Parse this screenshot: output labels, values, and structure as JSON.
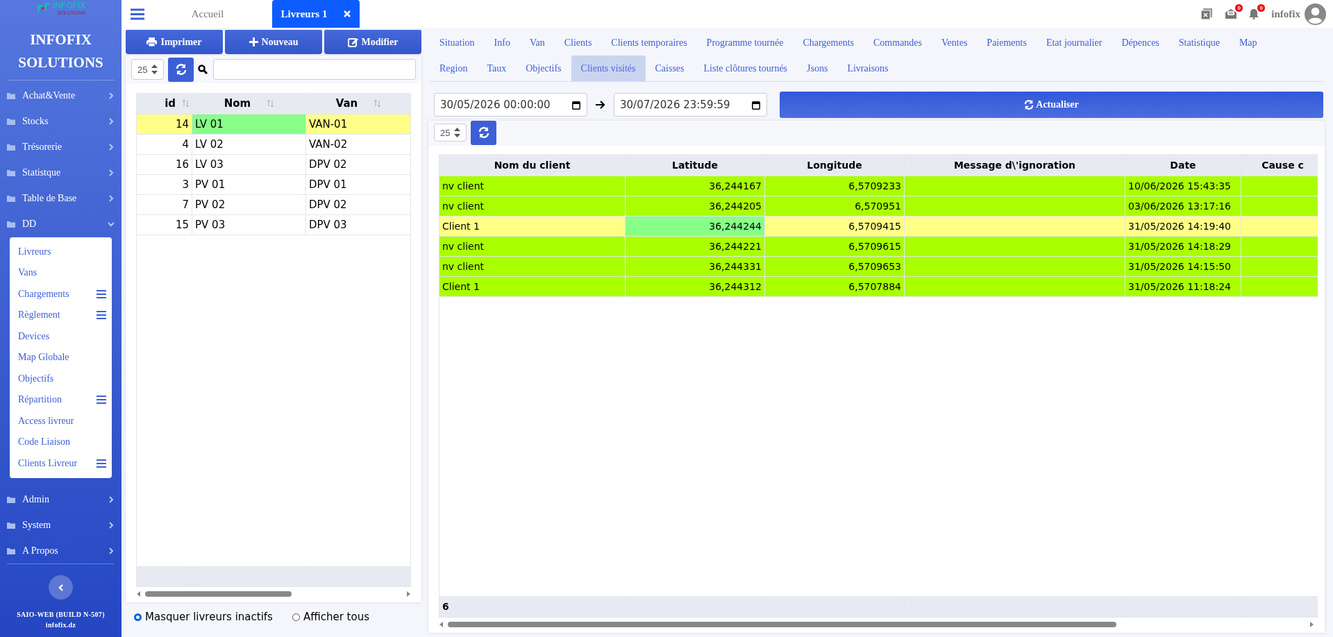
{
  "logo": {
    "name": "INFOFIX",
    "tagline": "SOLUTIONS"
  },
  "brand": [
    "INFOFIX",
    "SOLUTIONS"
  ],
  "sidebar": {
    "items": [
      {
        "label": "Achat&Vente",
        "expanded": false
      },
      {
        "label": "Stocks",
        "expanded": false
      },
      {
        "label": "Trésorerie",
        "expanded": false
      },
      {
        "label": "Statistque",
        "expanded": false
      },
      {
        "label": "Table de Base",
        "expanded": false
      },
      {
        "label": "DD",
        "expanded": true,
        "children": [
          {
            "label": "Livreurs",
            "kind": "link"
          },
          {
            "label": "Vans",
            "kind": "link"
          },
          {
            "label": "Chargements",
            "kind": "group"
          },
          {
            "label": "Règlement",
            "kind": "group"
          },
          {
            "label": "Devices",
            "kind": "link"
          },
          {
            "label": "Map Globale",
            "kind": "link"
          },
          {
            "label": "Objectifs",
            "kind": "link"
          },
          {
            "label": "Répartition",
            "kind": "group"
          },
          {
            "label": "Access livreur",
            "kind": "link"
          },
          {
            "label": "Code Liaison",
            "kind": "link"
          },
          {
            "label": "Clients Livreur",
            "kind": "group"
          }
        ]
      },
      {
        "label": "Admin",
        "expanded": false
      },
      {
        "label": "System",
        "expanded": false
      },
      {
        "label": "A Propos",
        "expanded": false
      }
    ],
    "footer": [
      "SAIO-WEB (BUILD N-507)",
      "infofix.dz"
    ]
  },
  "page_tabs": [
    {
      "label": "Accueil",
      "selected": false
    },
    {
      "label": "Livreurs 1",
      "selected": true
    }
  ],
  "header": {
    "mail_badge": "0",
    "bell_badge": "0",
    "user": "infofix"
  },
  "left": {
    "buttons": [
      "Imprimer",
      "Nouveau",
      "Modifier"
    ],
    "page_size": "25",
    "columns": [
      "id",
      "Nom",
      "Van"
    ],
    "rows": [
      {
        "id": "14",
        "nom": "LV 01",
        "van": "VAN-01",
        "selected": true
      },
      {
        "id": "4",
        "nom": "LV 02",
        "van": "VAN-02",
        "selected": false
      },
      {
        "id": "16",
        "nom": "LV 03",
        "van": "DPV 02",
        "selected": false
      },
      {
        "id": "3",
        "nom": "PV 01",
        "van": "DPV 01",
        "selected": false
      },
      {
        "id": "7",
        "nom": "PV 02",
        "van": "DPV 02",
        "selected": false
      },
      {
        "id": "15",
        "nom": "PV 03",
        "van": "DPV 03",
        "selected": false
      }
    ],
    "filters": [
      {
        "label": "Masquer livreurs inactifs",
        "selected": true
      },
      {
        "label": "Afficher tous",
        "selected": false
      }
    ]
  },
  "tabs": [
    {
      "label": "Situation",
      "selected": false
    },
    {
      "label": "Info",
      "selected": false
    },
    {
      "label": "Van",
      "selected": false
    },
    {
      "label": "Clients",
      "selected": false
    },
    {
      "label": "Clients temporaires",
      "selected": false
    },
    {
      "label": "Programme tournée",
      "selected": false
    },
    {
      "label": "Chargements",
      "selected": false
    },
    {
      "label": "Commandes",
      "selected": false
    },
    {
      "label": "Ventes",
      "selected": false
    },
    {
      "label": "Paiements",
      "selected": false
    },
    {
      "label": "Etat journalier",
      "selected": false
    },
    {
      "label": "Dépences",
      "selected": false
    },
    {
      "label": "Statistique",
      "selected": false
    },
    {
      "label": "Map",
      "selected": false
    },
    {
      "label": "Region",
      "selected": false
    },
    {
      "label": "Taux",
      "selected": false
    },
    {
      "label": "Objectifs",
      "selected": false
    },
    {
      "label": "Clients visités",
      "selected": true
    },
    {
      "label": "Caisses",
      "selected": false
    },
    {
      "label": "Liste clôtures tournés",
      "selected": false
    },
    {
      "label": "Jsons",
      "selected": false
    },
    {
      "label": "Livraisons",
      "selected": false
    }
  ],
  "date_from": "30/05/2026 00:00:00",
  "date_to": "30/07/2026 23:59:59",
  "refresh_button": "Actualiser",
  "page_size": "25",
  "table": {
    "columns": [
      "Nom du client",
      "Latitude",
      "Longitude",
      "Message d\\'ignoration",
      "Date",
      "Cause c"
    ],
    "rows": [
      {
        "cells": [
          "nv client",
          "36,244167",
          "6,5709233",
          "",
          "10/06/2026 15:43:35",
          ""
        ],
        "selected": false
      },
      {
        "cells": [
          "nv client",
          "36,244205",
          "6,570951",
          "",
          "03/06/2026 13:17:16",
          ""
        ],
        "selected": false
      },
      {
        "cells": [
          "Client 1",
          "36,244244",
          "6,5709415",
          "",
          "31/05/2026 14:19:40",
          ""
        ],
        "selected": true
      },
      {
        "cells": [
          "nv client",
          "36,244221",
          "6,5709615",
          "",
          "31/05/2026 14:18:29",
          ""
        ],
        "selected": false
      },
      {
        "cells": [
          "nv client",
          "36,244331",
          "6,5709653",
          "",
          "31/05/2026 14:15:50",
          ""
        ],
        "selected": false
      },
      {
        "cells": [
          "Client 1",
          "36,244312",
          "6,5707884",
          "",
          "31/05/2026 11:18:24",
          ""
        ],
        "selected": false
      }
    ],
    "footer_count": "6"
  }
}
